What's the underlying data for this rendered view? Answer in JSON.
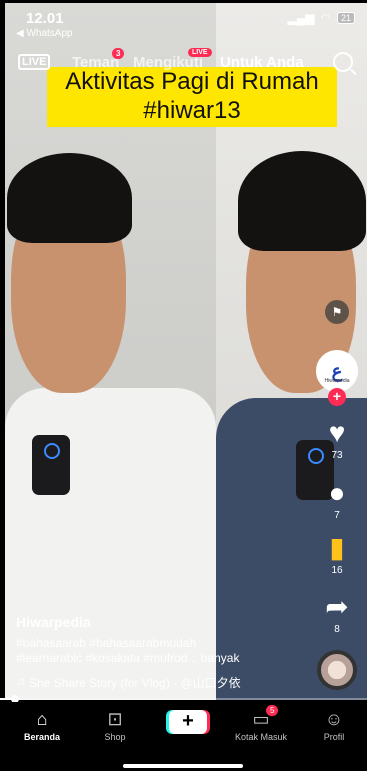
{
  "status_bar": {
    "time": "12.01",
    "back_label": "◀ WhatsApp",
    "battery": "21"
  },
  "top_nav": {
    "live_label": "LIVE",
    "tabs": [
      {
        "label": "Teman",
        "badge": "3"
      },
      {
        "label": "Mengikuti",
        "badge": "LIVE"
      },
      {
        "label": "Untuk Anda"
      }
    ]
  },
  "caption": {
    "line1": "Aktivitas Pagi di Rumah",
    "line2": "#hiwar13"
  },
  "side_rail": {
    "avatar_letter": "ع",
    "avatar_sub": "Hiwarpedia",
    "likes": "73",
    "comments": "7",
    "saves": "16",
    "shares": "8"
  },
  "post": {
    "creator": "Hiwarpedia",
    "tags_line1": "#bahasaarab #bahasaarabmudah",
    "tags_line2": "#learnarabic #kosakata #mufrod... banyak",
    "sound": "She Share Story (for Vlog) - @山口夕依",
    "progress": 0.04
  },
  "bottom_nav": {
    "items": [
      {
        "label": "Beranda"
      },
      {
        "label": "Shop"
      },
      {
        "label": "+"
      },
      {
        "label": "Kotak Masuk",
        "badge": "5"
      },
      {
        "label": "Profil"
      }
    ]
  },
  "colors": {
    "accent": "#fe2c55",
    "caption_bg": "#ffe600",
    "secondary": "#25f4ee"
  }
}
